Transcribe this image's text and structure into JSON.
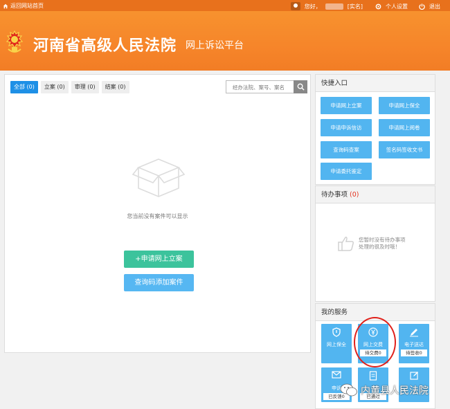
{
  "topbar": {
    "home_link": "返回网站首页",
    "greeting": "您好，",
    "realname": "[实名]",
    "settings": "个人设置",
    "logout": "退出"
  },
  "header": {
    "court_name": "河南省高级人民法院",
    "platform": "网上诉讼平台"
  },
  "case_tabs": [
    {
      "label": "全部 (0)"
    },
    {
      "label": "立案 (0)"
    },
    {
      "label": "审理 (0)"
    },
    {
      "label": "结案 (0)"
    }
  ],
  "search": {
    "placeholder": "经办法院、案号、案名"
  },
  "empty_message": "您当前没有案件可以显示",
  "actions": {
    "apply_case": "+申请网上立案",
    "query_add": "查询码添加案件"
  },
  "quick": {
    "title": "快捷入口",
    "items": [
      "申请网上立案",
      "申请网上保全",
      "申请申诉信访",
      "申请网上阅卷",
      "查询码查案",
      "签名码签收文书",
      "申请委托鉴定"
    ]
  },
  "todo": {
    "title": "待办事项",
    "count": "(0)",
    "empty_line1": "您暂时没有待办事项",
    "empty_line2": "处理的很及时哦！"
  },
  "services": {
    "title": "我的服务",
    "items": [
      {
        "label": "网上保全",
        "badge": ""
      },
      {
        "label": "网上交费",
        "badge": "待交费0"
      },
      {
        "label": "电子送达",
        "badge": "待签收0"
      },
      {
        "label": "申诉",
        "badge": "已反馈0"
      },
      {
        "label": "",
        "badge": "已通过"
      }
    ]
  },
  "watermark": "内黄县人民法院"
}
